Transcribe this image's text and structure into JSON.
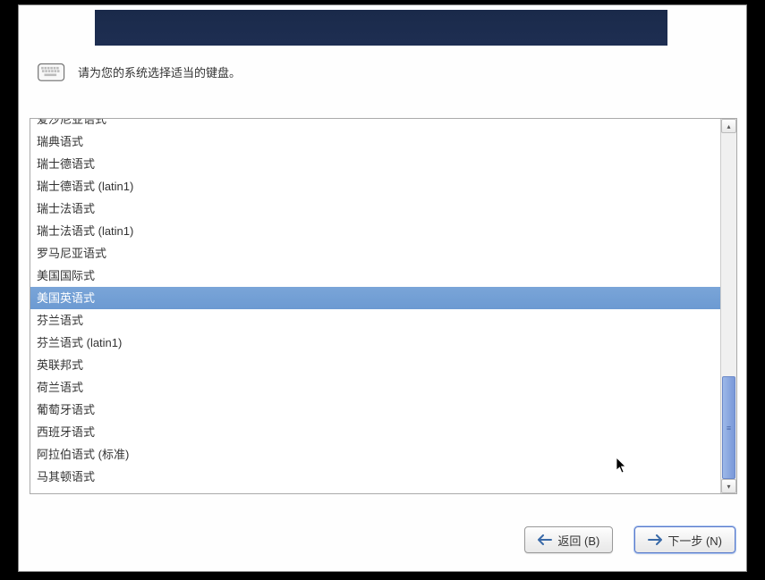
{
  "instruction": "请为您的系统选择适当的键盘。",
  "keyboard_list": {
    "selected_index": 8,
    "items": [
      "爱沙尼亚语式",
      "瑞典语式",
      "瑞士德语式",
      "瑞士德语式 (latin1)",
      "瑞士法语式",
      "瑞士法语式 (latin1)",
      "罗马尼亚语式",
      "美国国际式",
      "美国英语式",
      "芬兰语式",
      "芬兰语式 (latin1)",
      "英联邦式",
      "荷兰语式",
      "葡萄牙语式",
      "西班牙语式",
      "阿拉伯语式 (标准)",
      "马其顿语式"
    ]
  },
  "buttons": {
    "back": "返回 (B)",
    "next": "下一步 (N)"
  }
}
